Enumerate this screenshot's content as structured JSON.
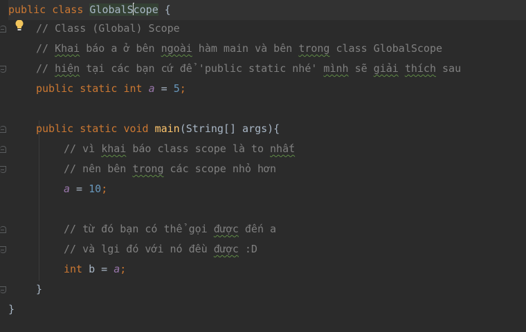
{
  "code": {
    "l1": {
      "kw1": "public",
      "kw2": "class",
      "name_a": "GlobalS",
      "name_b": "cope",
      "brace": "{"
    },
    "l2": {
      "comment": "// Class (Global) Scope"
    },
    "l3": {
      "p1": "// ",
      "w1": "Khai",
      "p2": " báo a ở bên ",
      "w2": "ngoài",
      "p3": " hàm main và bên ",
      "w3": "trong",
      "p4": " class GlobalScope"
    },
    "l4": {
      "p1": "// ",
      "w1": "hiện",
      "p2": " tại các bạn cứ để 'public static nhé' ",
      "w2": "mình",
      "p3": " sẽ ",
      "w3": "giải",
      "p4": " ",
      "w4": "thích",
      "p5": " sau"
    },
    "l5": {
      "kw1": "public",
      "kw2": "static",
      "kw3": "int",
      "var": "a",
      "eq": " = ",
      "num": "5",
      "semi": ";"
    },
    "l7": {
      "kw1": "public",
      "kw2": "static",
      "kw3": "void",
      "fn": "main",
      "params": "(String[] args){"
    },
    "l8": {
      "p1": "// vì ",
      "w1": "khai",
      "p2": " báo class scope là to ",
      "w2": "nhất"
    },
    "l9": {
      "p1": "// nên bên ",
      "w1": "trong",
      "p2": " các scope nhỏ hơn"
    },
    "l10": {
      "var": "a",
      "eq": " = ",
      "num": "10",
      "semi": ";"
    },
    "l12": {
      "p1": "// từ đó bạn có thể gọi ",
      "w1": "được",
      "p2": " đến a"
    },
    "l13": {
      "p1": "// và lgi đó với nó đều ",
      "w1": "được",
      "p2": " :D"
    },
    "l14": {
      "kw": "int",
      "mid": " b = ",
      "var": "a",
      "semi": ";"
    },
    "l15": {
      "brace": "}"
    },
    "l16": {
      "brace": "}"
    }
  },
  "icons": {
    "intention": "lightbulb-icon"
  },
  "colors": {
    "background": "#2b2b2b",
    "keyword": "#cc7832",
    "comment": "#808080",
    "function": "#ffc66d",
    "number": "#6897bb",
    "static_field": "#9876aa"
  }
}
